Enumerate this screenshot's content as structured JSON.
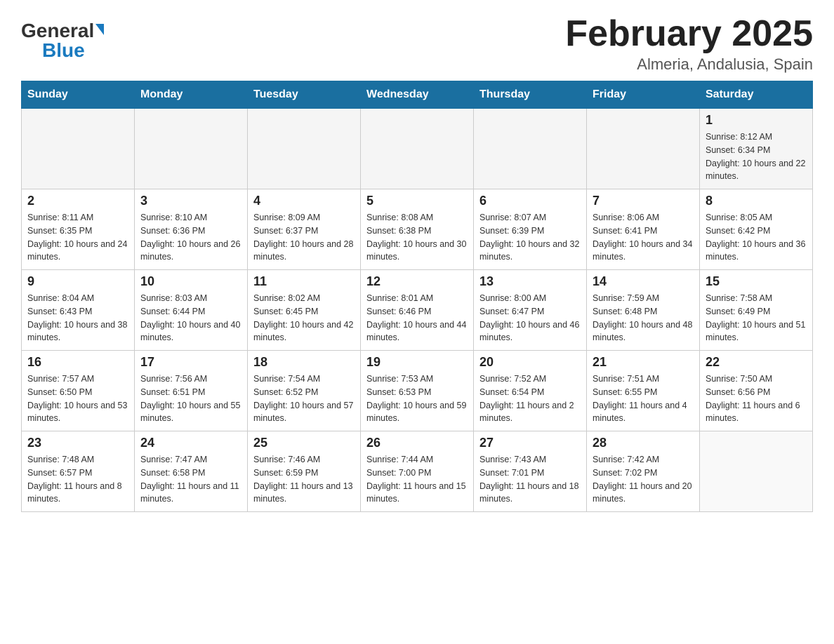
{
  "header": {
    "title": "February 2025",
    "location": "Almeria, Andalusia, Spain",
    "logo_general": "General",
    "logo_blue": "Blue"
  },
  "weekdays": [
    "Sunday",
    "Monday",
    "Tuesday",
    "Wednesday",
    "Thursday",
    "Friday",
    "Saturday"
  ],
  "weeks": [
    [
      {
        "day": "",
        "info": ""
      },
      {
        "day": "",
        "info": ""
      },
      {
        "day": "",
        "info": ""
      },
      {
        "day": "",
        "info": ""
      },
      {
        "day": "",
        "info": ""
      },
      {
        "day": "",
        "info": ""
      },
      {
        "day": "1",
        "info": "Sunrise: 8:12 AM\nSunset: 6:34 PM\nDaylight: 10 hours and 22 minutes."
      }
    ],
    [
      {
        "day": "2",
        "info": "Sunrise: 8:11 AM\nSunset: 6:35 PM\nDaylight: 10 hours and 24 minutes."
      },
      {
        "day": "3",
        "info": "Sunrise: 8:10 AM\nSunset: 6:36 PM\nDaylight: 10 hours and 26 minutes."
      },
      {
        "day": "4",
        "info": "Sunrise: 8:09 AM\nSunset: 6:37 PM\nDaylight: 10 hours and 28 minutes."
      },
      {
        "day": "5",
        "info": "Sunrise: 8:08 AM\nSunset: 6:38 PM\nDaylight: 10 hours and 30 minutes."
      },
      {
        "day": "6",
        "info": "Sunrise: 8:07 AM\nSunset: 6:39 PM\nDaylight: 10 hours and 32 minutes."
      },
      {
        "day": "7",
        "info": "Sunrise: 8:06 AM\nSunset: 6:41 PM\nDaylight: 10 hours and 34 minutes."
      },
      {
        "day": "8",
        "info": "Sunrise: 8:05 AM\nSunset: 6:42 PM\nDaylight: 10 hours and 36 minutes."
      }
    ],
    [
      {
        "day": "9",
        "info": "Sunrise: 8:04 AM\nSunset: 6:43 PM\nDaylight: 10 hours and 38 minutes."
      },
      {
        "day": "10",
        "info": "Sunrise: 8:03 AM\nSunset: 6:44 PM\nDaylight: 10 hours and 40 minutes."
      },
      {
        "day": "11",
        "info": "Sunrise: 8:02 AM\nSunset: 6:45 PM\nDaylight: 10 hours and 42 minutes."
      },
      {
        "day": "12",
        "info": "Sunrise: 8:01 AM\nSunset: 6:46 PM\nDaylight: 10 hours and 44 minutes."
      },
      {
        "day": "13",
        "info": "Sunrise: 8:00 AM\nSunset: 6:47 PM\nDaylight: 10 hours and 46 minutes."
      },
      {
        "day": "14",
        "info": "Sunrise: 7:59 AM\nSunset: 6:48 PM\nDaylight: 10 hours and 48 minutes."
      },
      {
        "day": "15",
        "info": "Sunrise: 7:58 AM\nSunset: 6:49 PM\nDaylight: 10 hours and 51 minutes."
      }
    ],
    [
      {
        "day": "16",
        "info": "Sunrise: 7:57 AM\nSunset: 6:50 PM\nDaylight: 10 hours and 53 minutes."
      },
      {
        "day": "17",
        "info": "Sunrise: 7:56 AM\nSunset: 6:51 PM\nDaylight: 10 hours and 55 minutes."
      },
      {
        "day": "18",
        "info": "Sunrise: 7:54 AM\nSunset: 6:52 PM\nDaylight: 10 hours and 57 minutes."
      },
      {
        "day": "19",
        "info": "Sunrise: 7:53 AM\nSunset: 6:53 PM\nDaylight: 10 hours and 59 minutes."
      },
      {
        "day": "20",
        "info": "Sunrise: 7:52 AM\nSunset: 6:54 PM\nDaylight: 11 hours and 2 minutes."
      },
      {
        "day": "21",
        "info": "Sunrise: 7:51 AM\nSunset: 6:55 PM\nDaylight: 11 hours and 4 minutes."
      },
      {
        "day": "22",
        "info": "Sunrise: 7:50 AM\nSunset: 6:56 PM\nDaylight: 11 hours and 6 minutes."
      }
    ],
    [
      {
        "day": "23",
        "info": "Sunrise: 7:48 AM\nSunset: 6:57 PM\nDaylight: 11 hours and 8 minutes."
      },
      {
        "day": "24",
        "info": "Sunrise: 7:47 AM\nSunset: 6:58 PM\nDaylight: 11 hours and 11 minutes."
      },
      {
        "day": "25",
        "info": "Sunrise: 7:46 AM\nSunset: 6:59 PM\nDaylight: 11 hours and 13 minutes."
      },
      {
        "day": "26",
        "info": "Sunrise: 7:44 AM\nSunset: 7:00 PM\nDaylight: 11 hours and 15 minutes."
      },
      {
        "day": "27",
        "info": "Sunrise: 7:43 AM\nSunset: 7:01 PM\nDaylight: 11 hours and 18 minutes."
      },
      {
        "day": "28",
        "info": "Sunrise: 7:42 AM\nSunset: 7:02 PM\nDaylight: 11 hours and 20 minutes."
      },
      {
        "day": "",
        "info": ""
      }
    ]
  ]
}
